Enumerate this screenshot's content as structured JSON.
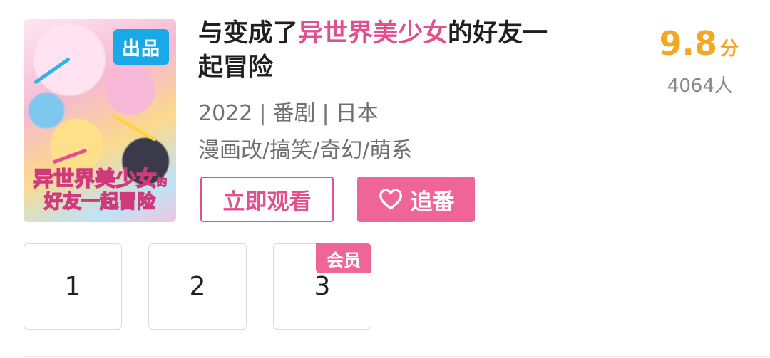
{
  "poster": {
    "badge": "出品",
    "title_line1": "异世界美少女",
    "title_small": "的",
    "title_line2": "好友一起冒险"
  },
  "title": {
    "prefix": "与变成了",
    "highlight": "异世界美少女",
    "suffix_line1": "的好友一",
    "suffix_line2": "起冒险",
    "highlight_color": "#e0508f"
  },
  "rating": {
    "score": "9.8",
    "unit": "分",
    "votes": "4064人",
    "color": "#f5a623"
  },
  "meta": {
    "year": "2022",
    "type": "番剧",
    "region": "日本",
    "separator": "|",
    "tags": "漫画改/搞笑/奇幻/萌系"
  },
  "actions": {
    "watch_label": "立即观看",
    "follow_label": "追番",
    "follow_icon": "heart-icon",
    "accent_color": "#f06597"
  },
  "episodes": [
    {
      "number": "1",
      "badge": ""
    },
    {
      "number": "2",
      "badge": ""
    },
    {
      "number": "3",
      "badge": "会员"
    }
  ]
}
